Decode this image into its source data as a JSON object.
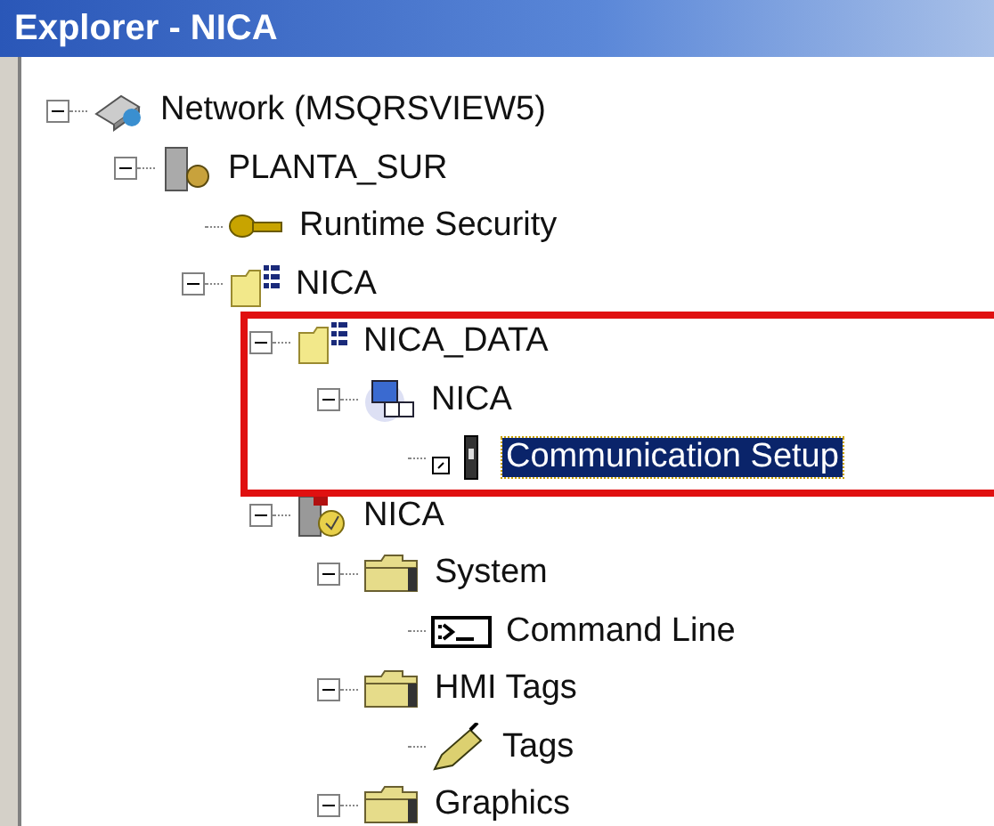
{
  "window": {
    "title": "Explorer - NICA"
  },
  "tree": [
    {
      "label": "Network (MSQRSVIEW5)",
      "kind": "network",
      "expanded": true,
      "selected": false,
      "children": [
        {
          "label": "PLANTA_SUR",
          "kind": "server",
          "expanded": true,
          "selected": false,
          "children": [
            {
              "label": "Runtime Security",
              "kind": "key",
              "selected": false
            },
            {
              "label": "NICA",
              "kind": "project",
              "expanded": true,
              "selected": false,
              "children": [
                {
                  "label": "NICA_DATA",
                  "kind": "project",
                  "expanded": true,
                  "selected": false,
                  "children": [
                    {
                      "label": "NICA",
                      "kind": "computer",
                      "expanded": true,
                      "selected": false,
                      "children": [
                        {
                          "label": "Communication Setup",
                          "kind": "device",
                          "selected": true
                        }
                      ]
                    }
                  ]
                },
                {
                  "label": "NICA",
                  "kind": "station",
                  "expanded": true,
                  "selected": false,
                  "children": [
                    {
                      "label": "System",
                      "kind": "folder",
                      "expanded": true,
                      "selected": false,
                      "children": [
                        {
                          "label": "Command Line",
                          "kind": "terminal",
                          "selected": false
                        }
                      ]
                    },
                    {
                      "label": "HMI Tags",
                      "kind": "folder",
                      "expanded": true,
                      "selected": false,
                      "children": [
                        {
                          "label": "Tags",
                          "kind": "pencil",
                          "selected": false
                        }
                      ]
                    },
                    {
                      "label": "Graphics",
                      "kind": "folder",
                      "expanded": true,
                      "selected": false
                    }
                  ]
                }
              ]
            }
          ]
        }
      ]
    }
  ],
  "annotation": {
    "kind": "highlight"
  }
}
